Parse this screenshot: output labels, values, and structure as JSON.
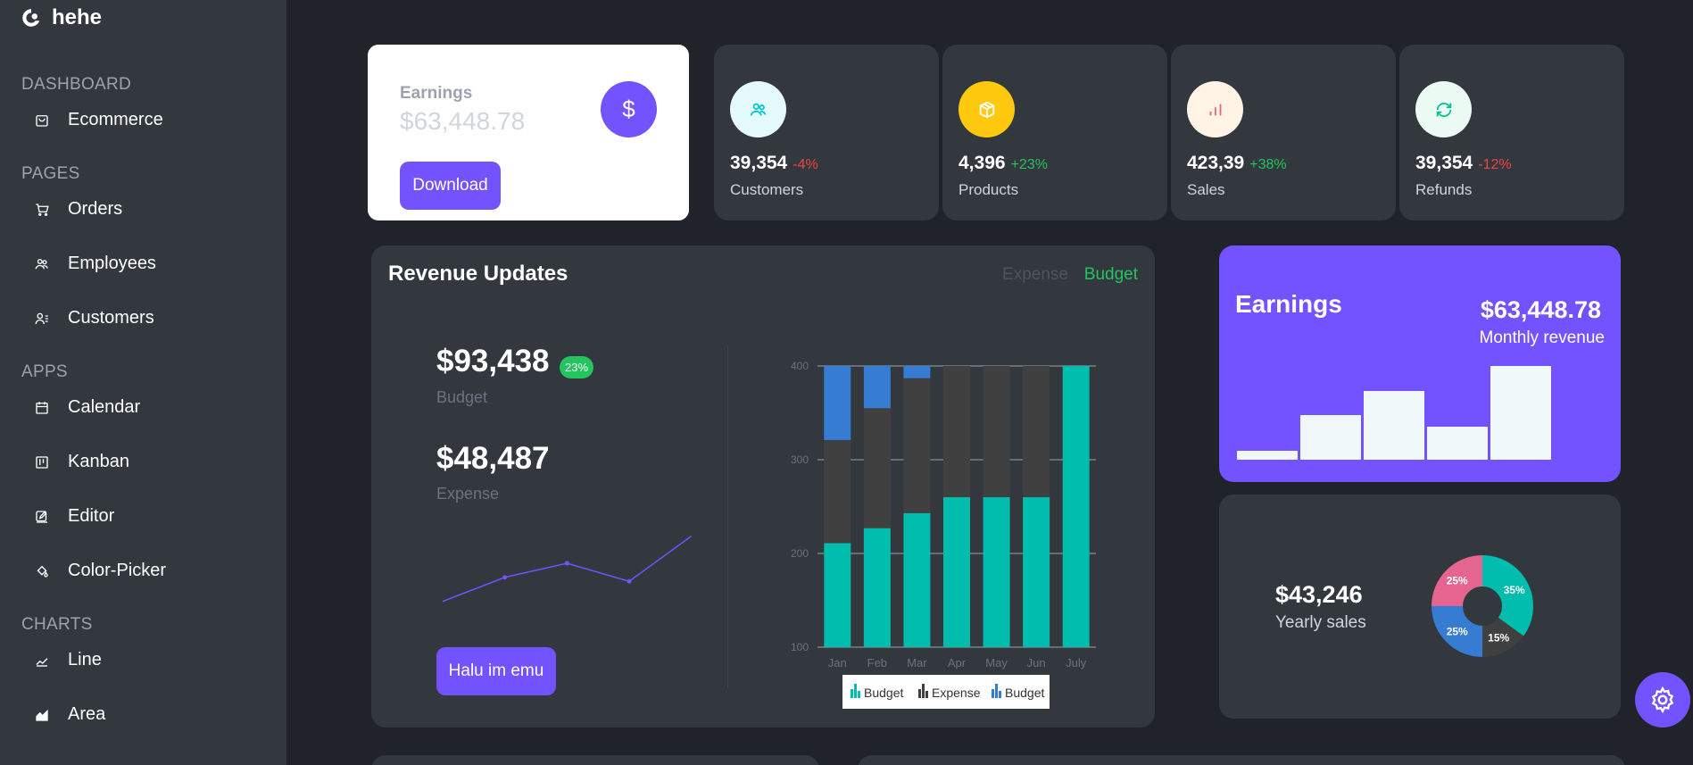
{
  "brand": {
    "name": "hehe"
  },
  "sidebar": {
    "sections": [
      {
        "title": "DASHBOARD",
        "items": [
          {
            "label": "Ecommerce",
            "icon": "bag-icon"
          }
        ]
      },
      {
        "title": "PAGES",
        "items": [
          {
            "label": "Orders",
            "icon": "cart-icon"
          },
          {
            "label": "Employees",
            "icon": "people-icon"
          },
          {
            "label": "Customers",
            "icon": "user-list-icon"
          }
        ]
      },
      {
        "title": "APPS",
        "items": [
          {
            "label": "Calendar",
            "icon": "calendar-icon"
          },
          {
            "label": "Kanban",
            "icon": "kanban-icon"
          },
          {
            "label": "Editor",
            "icon": "edit-icon"
          },
          {
            "label": "Color-Picker",
            "icon": "paint-bucket-icon"
          }
        ]
      },
      {
        "title": "CHARTS",
        "items": [
          {
            "label": "Line",
            "icon": "line-chart-icon"
          },
          {
            "label": "Area",
            "icon": "area-chart-icon"
          }
        ]
      }
    ]
  },
  "earnings_card": {
    "label": "Earnings",
    "value": "$63,448.78",
    "button": "Download"
  },
  "stats": [
    {
      "value": "39,354",
      "change": "-4%",
      "change_color": "#ef4444",
      "label": "Customers",
      "icon": "customers-icon",
      "icon_bg": "#e5fafb",
      "icon_color": "#03c9d7"
    },
    {
      "value": "4,396",
      "change": "+23%",
      "change_color": "#22c55e",
      "label": "Products",
      "icon": "box-icon",
      "icon_bg": "#fec90f",
      "icon_color": "#ffffff"
    },
    {
      "value": "423,39",
      "change": "+38%",
      "change_color": "#22c55e",
      "label": "Sales",
      "icon": "bar-chart-icon",
      "icon_bg": "#fff4e5",
      "icon_color": "#e46a76"
    },
    {
      "value": "39,354",
      "change": "-12%",
      "change_color": "#ef4444",
      "label": "Refunds",
      "icon": "refresh-icon",
      "icon_bg": "#ebfaf2",
      "icon_color": "#00c292"
    }
  ],
  "revenue": {
    "title": "Revenue Updates",
    "legend_expense": "Expense",
    "legend_budget": "Budget",
    "budget_value": "$93,438",
    "budget_badge": "23%",
    "budget_label": "Budget",
    "expense_value": "$48,487",
    "expense_label": "Expense",
    "button": "Halu im emu",
    "sparkline": [
      10,
      34,
      48,
      30,
      75
    ],
    "chart_legend": [
      "Budget",
      "Expense",
      "Budget"
    ]
  },
  "chart_data": [
    {
      "type": "bar",
      "stacked": true,
      "categories": [
        "Jan",
        "Feb",
        "Mar",
        "Apr",
        "May",
        "Jun",
        "July"
      ],
      "y_ticks": [
        100,
        200,
        300,
        400
      ],
      "ylim": [
        100,
        400
      ],
      "series": [
        {
          "name": "Budget",
          "color": "#00bdae",
          "values": [
            111,
            127,
            143,
            160,
            160,
            160,
            400
          ]
        },
        {
          "name": "Expense",
          "color": "#404041",
          "values": [
            110,
            128,
            144,
            160,
            160,
            160,
            0
          ]
        },
        {
          "name": "Budget",
          "color": "#357cd2",
          "values": [
            111,
            127,
            113,
            80,
            80,
            80,
            0
          ]
        }
      ],
      "legend": "bottom"
    },
    {
      "type": "bar",
      "values": [
        10,
        50,
        77,
        37,
        105
      ],
      "color": "#f0f8fa"
    },
    {
      "type": "pie",
      "labels": [
        "35%",
        "15%",
        "25%",
        "25%"
      ],
      "values": [
        35,
        15,
        25,
        25
      ],
      "colors": [
        "#00bdae",
        "#404041",
        "#357cd2",
        "#e56590"
      ]
    }
  ],
  "monthly": {
    "title": "Earnings",
    "value": "$63,448.78",
    "label": "Monthly revenue"
  },
  "yearly": {
    "value": "$43,246",
    "label": "Yearly sales"
  }
}
